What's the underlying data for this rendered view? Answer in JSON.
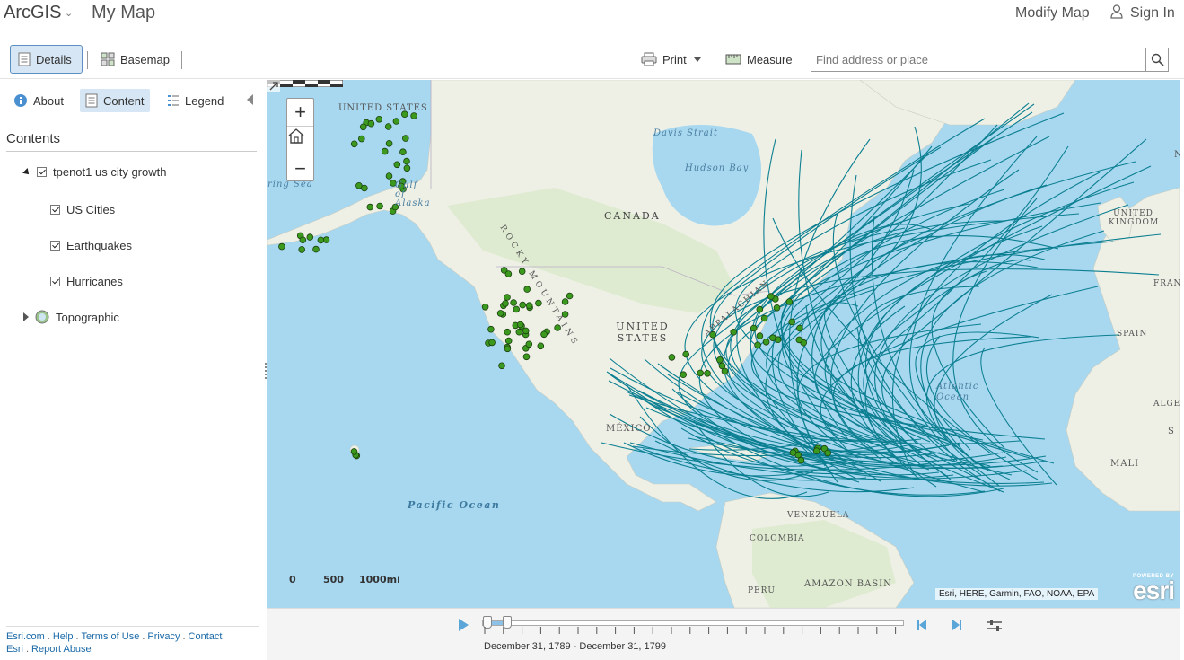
{
  "header": {
    "brand": "ArcGIS",
    "map_title": "My Map",
    "modify_map": "Modify Map",
    "sign_in": "Sign In"
  },
  "toolbar": {
    "details": "Details",
    "basemap": "Basemap",
    "print": "Print",
    "measure": "Measure",
    "search_placeholder": "Find address or place"
  },
  "panel": {
    "tabs": {
      "about": "About",
      "content": "Content",
      "legend": "Legend"
    },
    "contents_title": "Contents",
    "group_layer": "tpenot1 us city growth",
    "layers": [
      "US Cities",
      "Earthquakes",
      "Hurricanes"
    ],
    "basemap_layer": "Topographic"
  },
  "footer": {
    "links": [
      "Esri.com",
      "Help",
      "Terms of Use",
      "Privacy",
      "Contact Esri",
      "Report Abuse"
    ]
  },
  "map": {
    "labels": {
      "united_states_ak": "UNITED STATES",
      "davis_strait": "Davis Strait",
      "hudson_bay": "Hudson Bay",
      "canada": "CANADA",
      "rocky_mountains": "ROCKY MOUNTAINS",
      "gulf_of_alaska": "Gulf of Alaska",
      "bering_sea": "ring Sea",
      "united_states": "UNITED STATES",
      "united_kingdom": "UNITED KINGDOM",
      "france": "FRANC",
      "spain": "SPAIN",
      "algeria": "ALGERI",
      "sahara": "S A",
      "mali": "MALI",
      "mexico": "MÉXICO",
      "atlantic_ocean": "Atlantic Ocean",
      "pacific_ocean": "Pacific Ocean",
      "venezuela": "VENEZUELA",
      "colombia": "COLOMBIA",
      "peru": "PERU",
      "amazon_basin": "AMAZON BASIN",
      "appalachian": "APPALACHIAN",
      "edge_n": "N"
    },
    "scale": [
      "0",
      "500",
      "1000mi"
    ],
    "attribution": "Esri, HERE, Garmin, FAO, NOAA, EPA",
    "esri_powered": "POWERED BY",
    "esri_name": "esri",
    "colors": {
      "hurricane": "#0b7f91",
      "city": "#3b9a1e",
      "water": "#a8d8f0",
      "land": "#eef0e6"
    }
  },
  "time": {
    "range_label": "December 31, 1789 - December 31, 1799"
  }
}
